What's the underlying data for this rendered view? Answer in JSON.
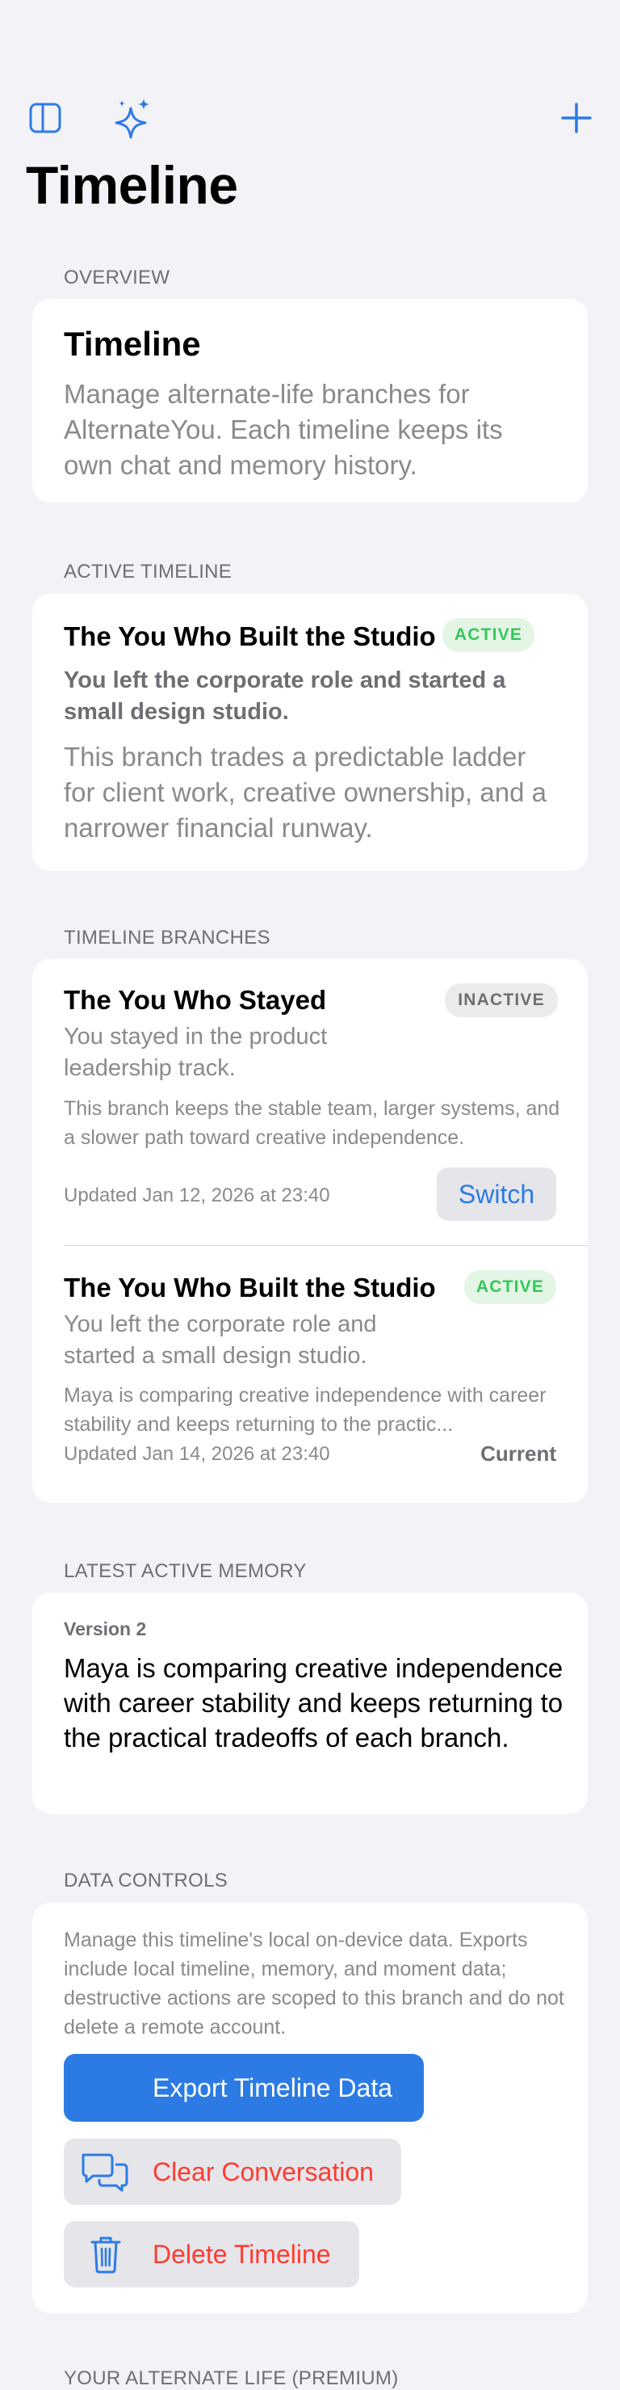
{
  "nav": {
    "title": "Timeline",
    "sidebar_icon": "sidebar-icon",
    "sparkles_icon": "sparkles-icon",
    "add_icon": "plus-icon"
  },
  "overview": {
    "header": "OVERVIEW",
    "title": "Timeline",
    "body": "Manage alternate-life branches for AlternateYou. Each timeline keeps its own chat and memory history."
  },
  "active_timeline": {
    "header": "ACTIVE TIMELINE",
    "title": "The You Who Built the Studio",
    "badge": "ACTIVE",
    "subtitle": "You left the corporate role and started a small design studio.",
    "body": "This branch trades a predictable ladder for client work, creative ownership, and a narrower financial runway."
  },
  "branches": {
    "header": "TIMELINE BRANCHES",
    "items": [
      {
        "title": "The You Who Stayed",
        "badge": "INACTIVE",
        "subtitle": "You stayed in the product leadership track.",
        "description": "This branch keeps the stable team, larger systems, and a slower path toward creative independence.",
        "updated": "Updated Jan 12, 2026 at 23:40",
        "action": "Switch"
      },
      {
        "title": "The You Who Built the Studio",
        "badge": "ACTIVE",
        "subtitle": "You left the corporate role and started a small design studio.",
        "description": "Maya is comparing creative independence with career stability and keeps returning to the practic...",
        "updated": "Updated Jan 14, 2026 at 23:40",
        "action": "Current"
      }
    ]
  },
  "memory": {
    "header": "LATEST ACTIVE MEMORY",
    "version": "Version 2",
    "text": "Maya is comparing creative independence with career stability and keeps returning to the practical tradeoffs of each branch."
  },
  "data_controls": {
    "header": "DATA CONTROLS",
    "description": "Manage this timeline's local on-device data. Exports include local timeline, memory, and moment data; destructive actions are scoped to this branch and do not delete a remote account.",
    "export_label": "Export Timeline Data",
    "clear_label": "Clear Conversation",
    "delete_label": "Delete Timeline"
  },
  "premium": {
    "header": "YOUR ALTERNATE LIFE (PREMIUM)"
  },
  "colors": {
    "accent": "#2c7be5",
    "destructive": "#ff3b30",
    "active_badge_text": "#34c759",
    "background": "#f2f2f7"
  }
}
